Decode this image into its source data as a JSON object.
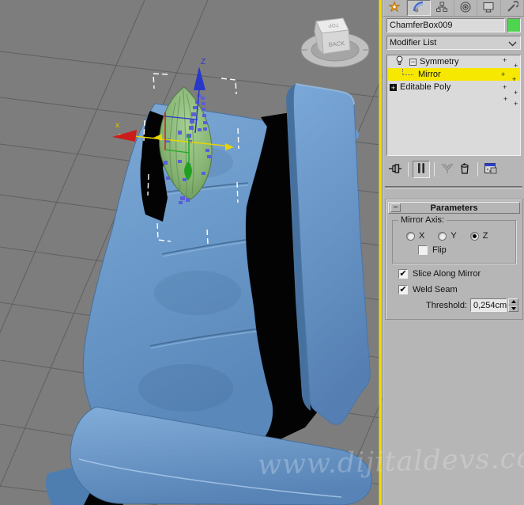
{
  "ui": {
    "plus_glyph": "+",
    "minus_glyph": "−",
    "check_glyph": "✔",
    "watermark": "www.dijitaldevs.com"
  },
  "colors": {
    "selection_highlight": "#f6e800",
    "object_color_swatch": "#4fd44f",
    "viewport_background": "#7d7d7d",
    "active_viewport_border": "#f2dc00",
    "x_axis": "#cc2020",
    "y_axis": "#22aa22",
    "z_axis": "#2838c8",
    "mirror_gizmo_axis": "#e8d400",
    "sofa_blue": "#5d8fc4"
  },
  "viewport": {
    "x_axis_label": "x",
    "z_axis_label": "Z",
    "viewcube": {
      "front_label": "BACK",
      "top_label": "TOP"
    }
  },
  "command_panel": {
    "tabs": [
      {
        "icon": "create-icon",
        "active": false
      },
      {
        "icon": "modify-icon",
        "active": true
      },
      {
        "icon": "hierarchy-icon",
        "active": false
      },
      {
        "icon": "motion-icon",
        "active": false
      },
      {
        "icon": "display-icon",
        "active": false
      },
      {
        "icon": "utilities-icon",
        "active": false
      }
    ],
    "object_name": "ChamferBox009",
    "modifier_list": {
      "label": "Modifier List"
    },
    "modifier_stack": [
      {
        "label": "Symmetry",
        "expanded": true,
        "enabled": true
      },
      {
        "label": "Mirror",
        "selected": true
      },
      {
        "label": "Editable Poly",
        "collapsed": true
      }
    ],
    "stack_toolbar": [
      {
        "icon": "pin-stack-icon",
        "active": false
      },
      {
        "icon": "show-end-result-icon",
        "active": true
      },
      {
        "icon": "make-unique-icon",
        "disabled": true
      },
      {
        "icon": "remove-modifier-icon",
        "disabled": false
      },
      {
        "icon": "configure-modifier-sets-icon",
        "disabled": false
      }
    ],
    "parameters": {
      "title": "Parameters",
      "mirror_axis": {
        "group_label": "Mirror Axis:",
        "x_label": "X",
        "y_label": "Y",
        "z_label": "Z",
        "selected": "Z",
        "flip_label": "Flip",
        "flip_checked": false
      },
      "slice_label": "Slice Along Mirror",
      "slice_checked": true,
      "weld_label": "Weld Seam",
      "weld_checked": true,
      "threshold_label": "Threshold:",
      "threshold_value": "0,254cm"
    }
  }
}
